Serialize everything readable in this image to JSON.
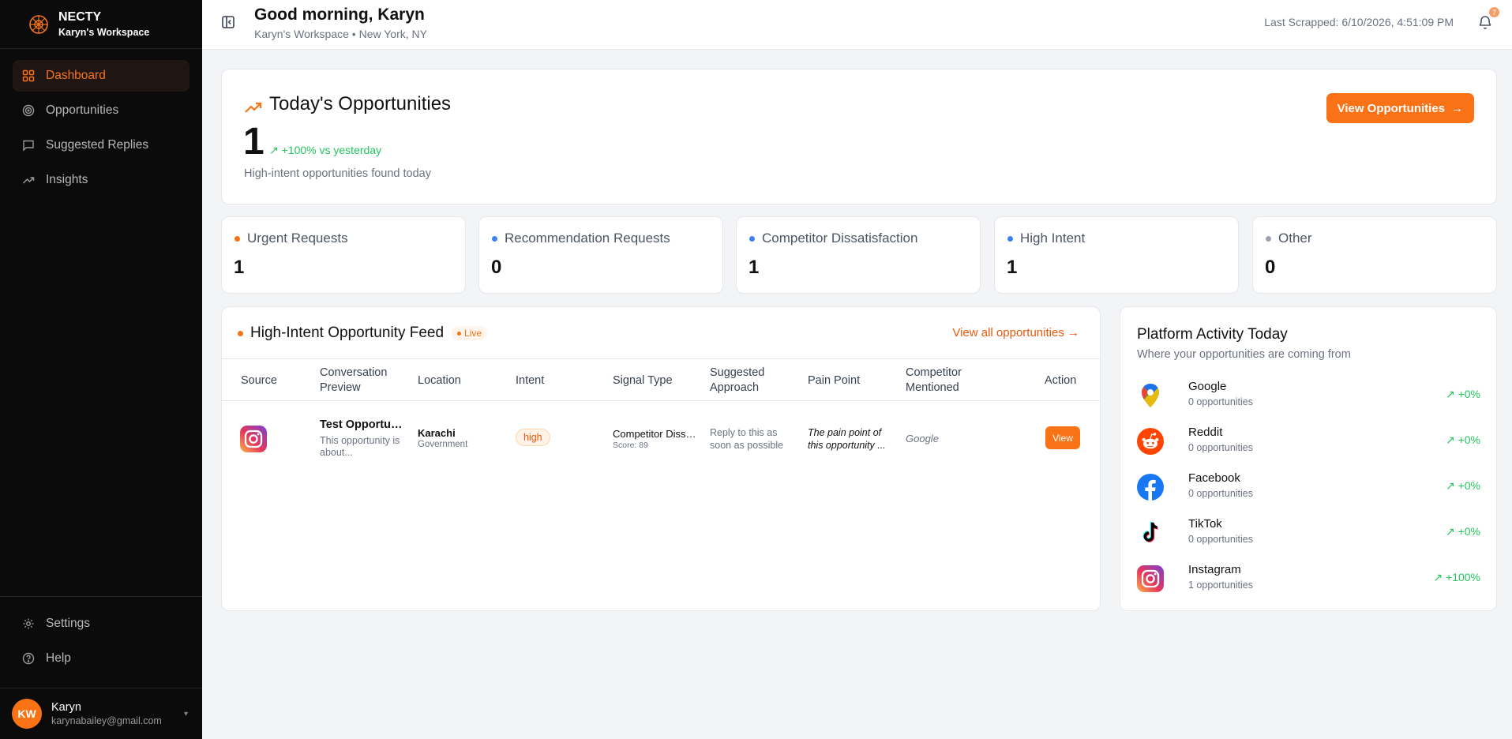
{
  "brand": {
    "name": "NECTY",
    "workspace": "Karyn's Workspace"
  },
  "nav": {
    "items": [
      {
        "label": "Dashboard"
      },
      {
        "label": "Opportunities"
      },
      {
        "label": "Suggested Replies"
      },
      {
        "label": "Insights"
      }
    ],
    "bottom": [
      {
        "label": "Settings"
      },
      {
        "label": "Help"
      }
    ]
  },
  "user": {
    "initials": "KW",
    "name": "Karyn",
    "email": "karynabailey@gmail.com"
  },
  "header": {
    "greeting": "Good morning, Karyn",
    "subtitle": "Karyn's Workspace • New York, NY",
    "last_scraped": "Last Scrapped: 6/10/2026, 4:51:09 PM",
    "notification_count": "7"
  },
  "hero": {
    "title": "Today's Opportunities",
    "count": "1",
    "delta": "+100% vs yesterday",
    "subtitle": "High-intent opportunities found today",
    "button": "View Opportunities"
  },
  "stats": [
    {
      "label": "Urgent Requests",
      "value": "1",
      "color": "#f97316"
    },
    {
      "label": "Recommendation Requests",
      "value": "0",
      "color": "#3b82f6"
    },
    {
      "label": "Competitor Dissatisfaction",
      "value": "1",
      "color": "#3b82f6"
    },
    {
      "label": "High Intent",
      "value": "1",
      "color": "#3b82f6"
    },
    {
      "label": "Other",
      "value": "0",
      "color": "#9ca3af"
    }
  ],
  "feed": {
    "title": "High-Intent Opportunity Feed",
    "live": "Live",
    "view_all": "View all opportunities",
    "columns": [
      "Source",
      "Conversation Preview",
      "Location",
      "Intent",
      "Signal Type",
      "Suggested Approach",
      "Pain Point",
      "Competitor Mentioned",
      "Action"
    ],
    "rows": [
      {
        "source_icon": "instagram-icon",
        "preview_title": "Test Opportunity",
        "preview_desc": "This opportunity is about...",
        "location": "Karachi",
        "location_sub": "Government",
        "intent": "high",
        "signal": "Competitor Dissatisfaction",
        "score": "Score: 89",
        "approach": "Reply to this as soon as possible",
        "pain": "The pain point of this opportunity ...",
        "competitor": "Google",
        "action": "View"
      }
    ]
  },
  "platforms": {
    "title": "Platform Activity Today",
    "subtitle": "Where your opportunities are coming from",
    "items": [
      {
        "name": "Google",
        "count": "0 opportunities",
        "delta": "+0%",
        "icon": "google-maps-icon"
      },
      {
        "name": "Reddit",
        "count": "0 opportunities",
        "delta": "+0%",
        "icon": "reddit-icon"
      },
      {
        "name": "Facebook",
        "count": "0 opportunities",
        "delta": "+0%",
        "icon": "facebook-icon"
      },
      {
        "name": "TikTok",
        "count": "0 opportunities",
        "delta": "+0%",
        "icon": "tiktok-icon"
      },
      {
        "name": "Instagram",
        "count": "1 opportunities",
        "delta": "+100%",
        "icon": "instagram-icon"
      }
    ]
  },
  "colors": {
    "accent": "#f97316",
    "positive": "#22c55e",
    "sidebar_bg": "#0b0b0c"
  }
}
